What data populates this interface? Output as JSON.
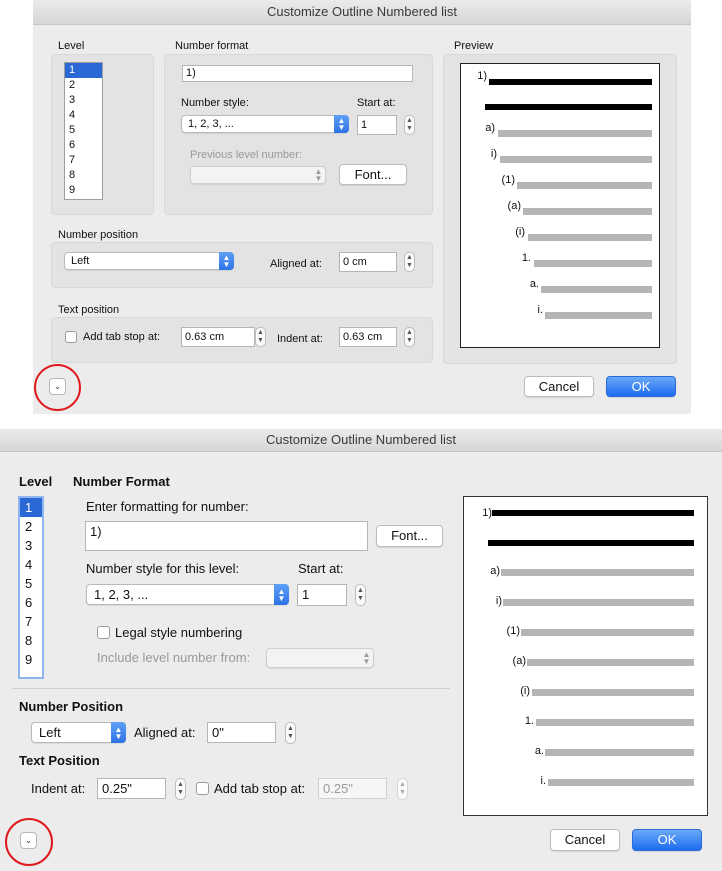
{
  "top": {
    "title": "Customize Outline Numbered list",
    "level_label": "Level",
    "levels": [
      "1",
      "2",
      "3",
      "4",
      "5",
      "6",
      "7",
      "8",
      "9"
    ],
    "number_format_label": "Number format",
    "number_format_value": "1)",
    "number_style_label": "Number style:",
    "number_style_value": "1, 2, 3, ...",
    "start_at_label": "Start at:",
    "start_at_value": "1",
    "previous_level_label": "Previous level number:",
    "font_button": "Font...",
    "number_position_label": "Number position",
    "number_position_value": "Left",
    "aligned_at_label": "Aligned at:",
    "aligned_at_value": "0 cm",
    "text_position_label": "Text position",
    "add_tab_stop_label": "Add tab stop at:",
    "add_tab_stop_value": "0.63 cm",
    "indent_at_label": "Indent at:",
    "indent_at_value": "0.63 cm",
    "preview_label": "Preview",
    "cancel": "Cancel",
    "ok": "OK"
  },
  "bottom": {
    "title": "Customize Outline Numbered list",
    "level_label": "Level",
    "levels": [
      "1",
      "2",
      "3",
      "4",
      "5",
      "6",
      "7",
      "8",
      "9"
    ],
    "number_format_label": "Number Format",
    "enter_formatting_label": "Enter formatting for number:",
    "number_format_value": "1)",
    "font_button": "Font...",
    "number_style_label": "Number style for this level:",
    "number_style_value": "1, 2, 3, ...",
    "start_at_label": "Start at:",
    "start_at_value": "1",
    "legal_style_label": "Legal style numbering",
    "include_level_label": "Include level number from:",
    "number_position_label": "Number Position",
    "number_position_value": "Left",
    "aligned_at_label": "Aligned at:",
    "aligned_at_value": "0\"",
    "text_position_label": "Text Position",
    "indent_at_label": "Indent at:",
    "indent_at_value": "0.25\"",
    "add_tab_stop_label": "Add tab stop at:",
    "add_tab_stop_value": "0.25\"",
    "cancel": "Cancel",
    "ok": "OK"
  },
  "preview_levels": [
    "1)",
    "a)",
    "i)",
    "(1)",
    "(a)",
    "(i)",
    "1.",
    "a.",
    "i."
  ],
  "icons": {
    "disclosure": "chevron-down-icon",
    "popup_arrows": "up-down-chevron-icon",
    "stepper": "stepper-arrows-icon"
  },
  "colors": {
    "accent": "#2a68d6",
    "highlight_circle": "#e0191f",
    "window_bg": "#ececec"
  }
}
